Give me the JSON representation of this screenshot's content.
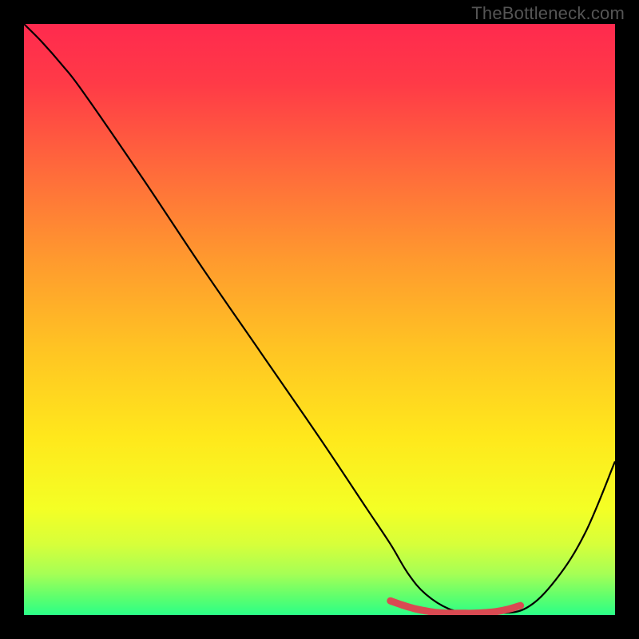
{
  "watermark": "TheBottleneck.com",
  "chart_data": {
    "type": "line",
    "title": "",
    "xlabel": "",
    "ylabel": "",
    "xlim": [
      0,
      100
    ],
    "ylim": [
      0,
      100
    ],
    "legend": false,
    "grid": false,
    "series": [
      {
        "name": "curve",
        "x": [
          0,
          3,
          6.5,
          10,
          20,
          30,
          40,
          50,
          58,
          62,
          65,
          68,
          72,
          76,
          80,
          85,
          90,
          95,
          100
        ],
        "y": [
          100,
          97,
          93,
          88.5,
          74,
          59,
          44.5,
          30,
          18,
          12,
          7,
          3.5,
          1,
          0.3,
          0.3,
          1.2,
          6,
          14,
          26
        ]
      },
      {
        "name": "highlight",
        "x": [
          62,
          64,
          66,
          68,
          70,
          72,
          74,
          76,
          78,
          80,
          82,
          84
        ],
        "y": [
          2.4,
          1.7,
          1.1,
          0.7,
          0.4,
          0.3,
          0.3,
          0.3,
          0.4,
          0.6,
          1.0,
          1.6
        ]
      }
    ],
    "gradient_stops": [
      {
        "offset": 0,
        "color": "#ff2a4e"
      },
      {
        "offset": 0.1,
        "color": "#ff3a47"
      },
      {
        "offset": 0.25,
        "color": "#ff6b3b"
      },
      {
        "offset": 0.4,
        "color": "#ff9a2e"
      },
      {
        "offset": 0.55,
        "color": "#ffc423"
      },
      {
        "offset": 0.7,
        "color": "#ffe81c"
      },
      {
        "offset": 0.82,
        "color": "#f4ff25"
      },
      {
        "offset": 0.88,
        "color": "#d7ff3a"
      },
      {
        "offset": 0.93,
        "color": "#a6ff55"
      },
      {
        "offset": 0.97,
        "color": "#5dff6e"
      },
      {
        "offset": 1.0,
        "color": "#2bff87"
      }
    ],
    "highlight_color": "#d94a52",
    "curve_color": "#000000"
  }
}
